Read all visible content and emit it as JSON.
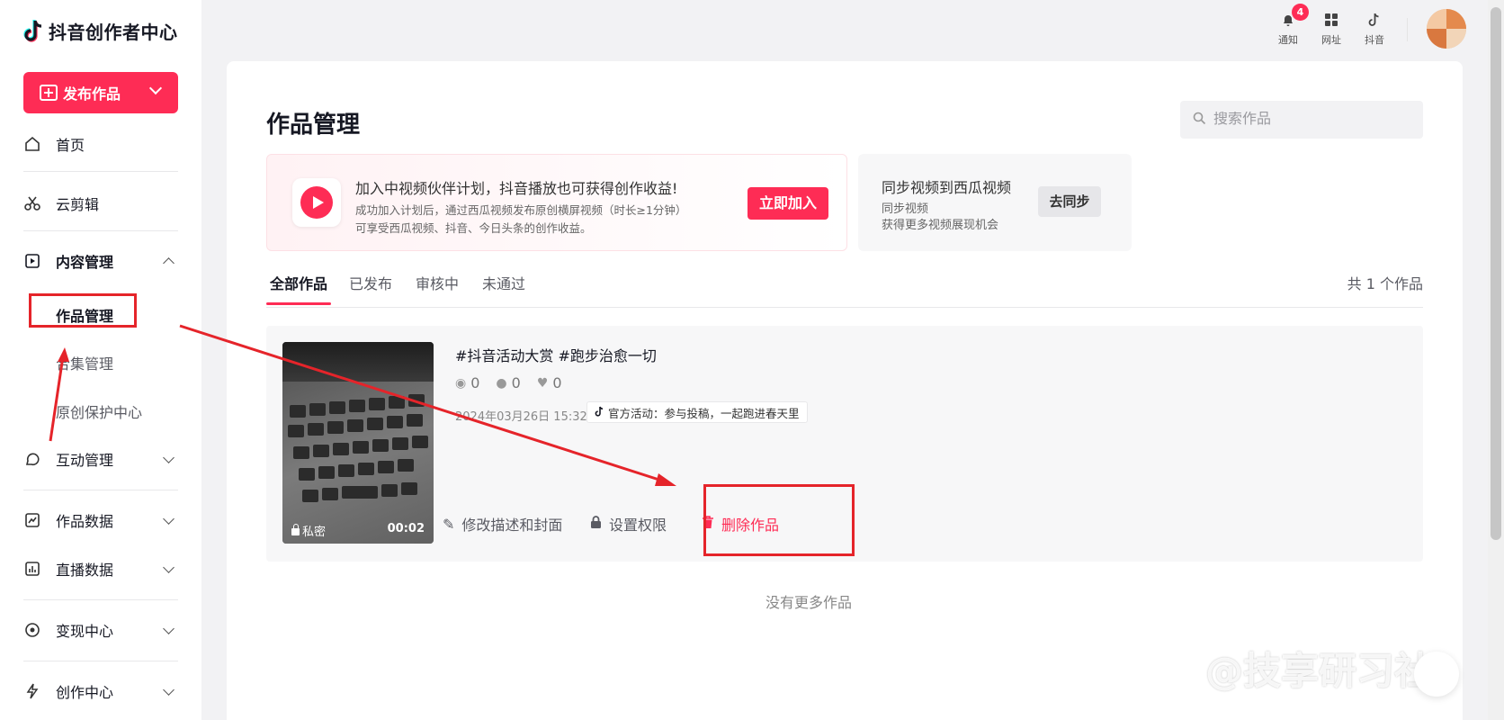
{
  "app": {
    "title": "抖音创作者中心"
  },
  "sidebar": {
    "publish_label": "发布作品",
    "items": [
      {
        "label": "首页",
        "icon": "home-icon"
      },
      {
        "label": "云剪辑",
        "icon": "scissors-icon"
      },
      {
        "label": "内容管理",
        "icon": "play-square-icon"
      },
      {
        "label": "互动管理",
        "icon": "chat-icon"
      },
      {
        "label": "作品数据",
        "icon": "line-chart-icon"
      },
      {
        "label": "直播数据",
        "icon": "bar-chart-icon"
      },
      {
        "label": "变现中心",
        "icon": "target-icon"
      },
      {
        "label": "创作中心",
        "icon": "lightning-icon"
      }
    ],
    "content_sub": [
      {
        "label": "作品管理"
      },
      {
        "label": "合集管理"
      },
      {
        "label": "原创保护中心"
      }
    ]
  },
  "topbar": {
    "notify_label": "通知",
    "notify_badge": "4",
    "address_label": "网址",
    "douyin_label": "抖音"
  },
  "main": {
    "title": "作品管理",
    "search_placeholder": "搜索作品",
    "promo": {
      "title": "加入中视频伙伴计划，抖音播放也可获得创作收益!",
      "desc": "成功加入计划后，通过西瓜视频发布原创横屏视频（时长≥1分钟）可享受西瓜视频、抖音、今日头条的创作收益。",
      "button": "立即加入"
    },
    "sync": {
      "title": "同步视频到西瓜视频",
      "sub1": "同步视频",
      "sub2": "获得更多视频展现机会",
      "button": "去同步"
    },
    "tabs": [
      "全部作品",
      "已发布",
      "审核中",
      "未通过"
    ],
    "count": "共 1 个作品",
    "video": {
      "title": "#抖音活动大赏 #跑步治愈一切",
      "views": "0",
      "comments": "0",
      "likes": "0",
      "date": "2024年03月26日 15:32",
      "activity": "官方活动：参与投稿，一起跑进春天里",
      "privacy": "私密",
      "duration": "00:02",
      "actions": {
        "edit": "修改描述和封面",
        "permission": "设置权限",
        "delete": "删除作品"
      }
    },
    "no_more": "没有更多作品"
  },
  "watermark": "@技享研习社",
  "colors": {
    "accent": "#fe2c55",
    "annotation": "#e5242a"
  }
}
